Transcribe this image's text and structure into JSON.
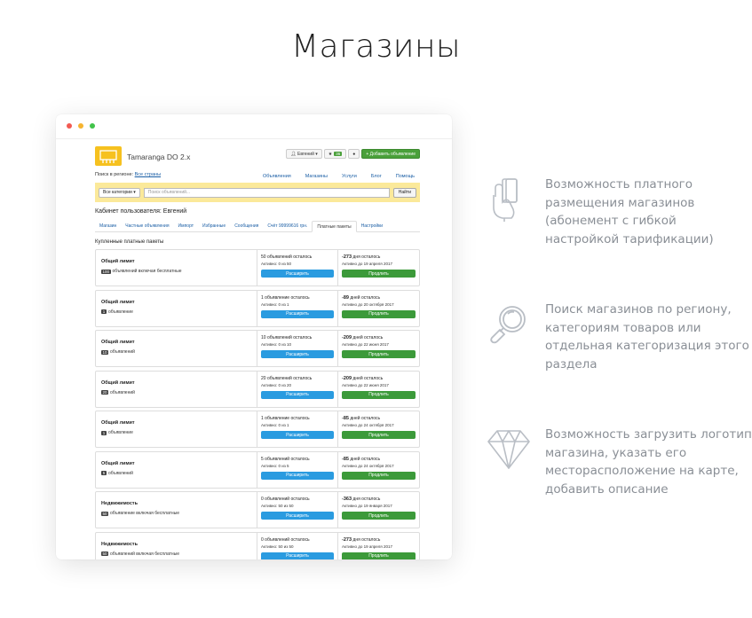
{
  "title": "Магазины",
  "window": {
    "dot_colors": [
      "#f25a52",
      "#f6b430",
      "#41c34a"
    ]
  },
  "site": {
    "logo_text": "Tamaranga DO 2.x",
    "user_label": "Евгений",
    "fav_count": "36",
    "add_button": "+ Добавить объявление",
    "region_label": "Поиск в регионе:",
    "region_value": "Все страны",
    "nav": [
      "Объявления",
      "Магазины",
      "Услуги",
      "Блог",
      "Помощь"
    ],
    "search": {
      "category": "Все категории",
      "placeholder": "Поиск объявлений...",
      "button": "Найти"
    },
    "cabinet_title": "Кабинет пользователя: Евгений",
    "tabs": [
      {
        "label": "Магазин",
        "active": false
      },
      {
        "label": "Частные объявления",
        "active": false
      },
      {
        "label": "Импорт",
        "active": false
      },
      {
        "label": "Избранные",
        "active": false
      },
      {
        "label": "Сообщения",
        "active": false
      },
      {
        "label": "Счёт 99999616 грн.",
        "active": false
      },
      {
        "label": "Платные пакеты",
        "active": true
      },
      {
        "label": "Настройки",
        "active": false
      }
    ],
    "section_title": "Купленные платные пакеты",
    "packages": [
      {
        "name": "Общий лимит",
        "count": "100",
        "desc": "объявлений включая бесплатные",
        "remaining": "50 объявлений осталось",
        "active": "Активно: 0 из 50",
        "extend": "Расширить",
        "days": "-273",
        "days_label": "дня осталось",
        "date": "Активно до 19 апреля 2017",
        "renew": "Продлить"
      },
      {
        "name": "Общий лимит",
        "count": "1",
        "desc": "объявление",
        "remaining": "1 объявление осталось",
        "active": "Активно: 0 из 1",
        "extend": "Расширить",
        "days": "-89",
        "days_label": "дней осталось",
        "date": "Активно до 20 октября 2017",
        "renew": "Продлить"
      },
      {
        "name": "Общий лимит",
        "count": "10",
        "desc": "объявлений",
        "remaining": "10 объявлений осталось",
        "active": "Активно: 0 из 10",
        "extend": "Расширить",
        "days": "-209",
        "days_label": "дней осталось",
        "date": "Активно до 22 июня 2017",
        "renew": "Продлить"
      },
      {
        "name": "Общий лимит",
        "count": "20",
        "desc": "объявлений",
        "remaining": "20 объявлений осталось",
        "active": "Активно: 0 из 20",
        "extend": "Расширить",
        "days": "-209",
        "days_label": "дней осталось",
        "date": "Активно до 22 июня 2017",
        "renew": "Продлить"
      },
      {
        "name": "Общий лимит",
        "count": "1",
        "desc": "объявление",
        "remaining": "1 объявление осталось",
        "active": "Активно: 0 из 1",
        "extend": "Расширить",
        "days": "-85",
        "days_label": "дней осталось",
        "date": "Активно до 24 октября 2017",
        "renew": "Продлить"
      },
      {
        "name": "Общий лимит",
        "count": "5",
        "desc": "объявлений",
        "remaining": "5 объявлений осталось",
        "active": "Активно: 0 из 5",
        "extend": "Расширить",
        "days": "-85",
        "days_label": "дней осталось",
        "date": "Активно до 24 октября 2017",
        "renew": "Продлить"
      },
      {
        "name": "Недвижимость",
        "count": "50",
        "desc": "объявление включая бесплатные",
        "remaining": "0 объявлений осталось",
        "active": "Активно: 50 из 50",
        "extend": "Расширить",
        "days": "-363",
        "days_label": "дня осталось",
        "date": "Активно до 19 января 2017",
        "renew": "Продлить"
      },
      {
        "name": "Недвижимость",
        "count": "50",
        "desc": "объявлений включая бесплатные",
        "remaining": "0 объявлений осталось",
        "active": "Активно: 50 из 50",
        "extend": "Расширить",
        "days": "-273",
        "days_label": "дня осталось",
        "date": "Активно до 19 апреля 2017",
        "renew": "Продлить"
      }
    ]
  },
  "features": [
    {
      "icon": "hand-card-icon",
      "text": "Возможность платного размещения магазинов (абонемент с гибкой настройкой тарификации)"
    },
    {
      "icon": "magnifier-icon",
      "text": "Поиск магазинов по региону, категориям товаров или отдельная категоризация этого раздела"
    },
    {
      "icon": "diamond-icon",
      "text": "Возможность загрузить логотип магазина, указать его месторасположение на карте, добавить описание"
    }
  ]
}
